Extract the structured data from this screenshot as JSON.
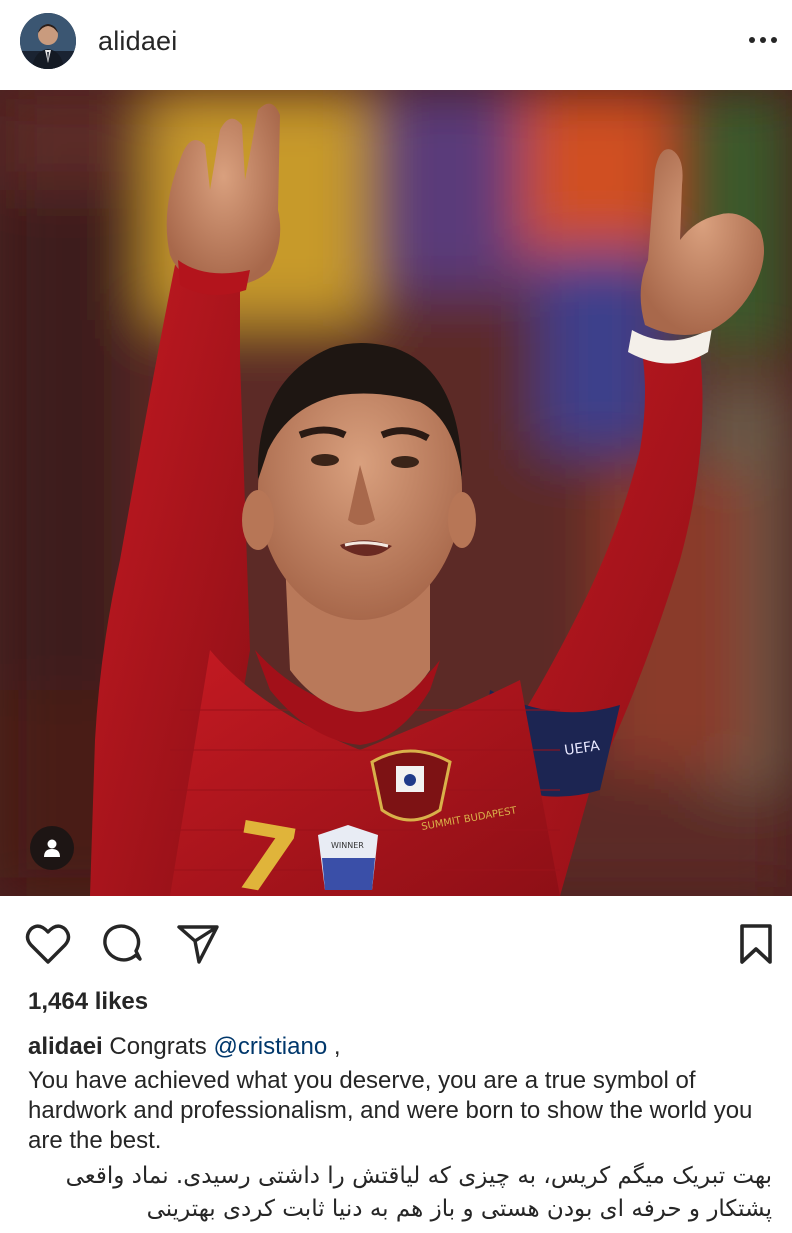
{
  "post": {
    "username": "alidaei",
    "likes": "1,464 likes",
    "caption": {
      "username": "alidaei",
      "lead": "Congrats",
      "mention": "@cristiano",
      "after_mention": " ,",
      "english": "You have achieved what you deserve, you are a true symbol of hardwork and professionalism, and were born to show the world you are the best.",
      "persian": "بهت تبریک میگم کریس، به چیزی که لیاقتش را داشتی رسیدی. نماد واقعی پشتکار و حرفه ای بودن هستی و باز هم به دنیا ثابت کردی بهترینی"
    },
    "jersey_number": "7",
    "armband_text": "UEFA",
    "badge_text": "WINNER",
    "badge_text2": "SUMMIT BUDAPEST"
  },
  "icons": {
    "more": "more-options-icon",
    "like": "heart-icon",
    "comment": "comment-icon",
    "share": "share-icon",
    "save": "bookmark-icon",
    "tag": "user-tag-icon"
  },
  "colors": {
    "jersey_red": "#b3141c",
    "text": "#262626",
    "mention": "#00376b"
  }
}
